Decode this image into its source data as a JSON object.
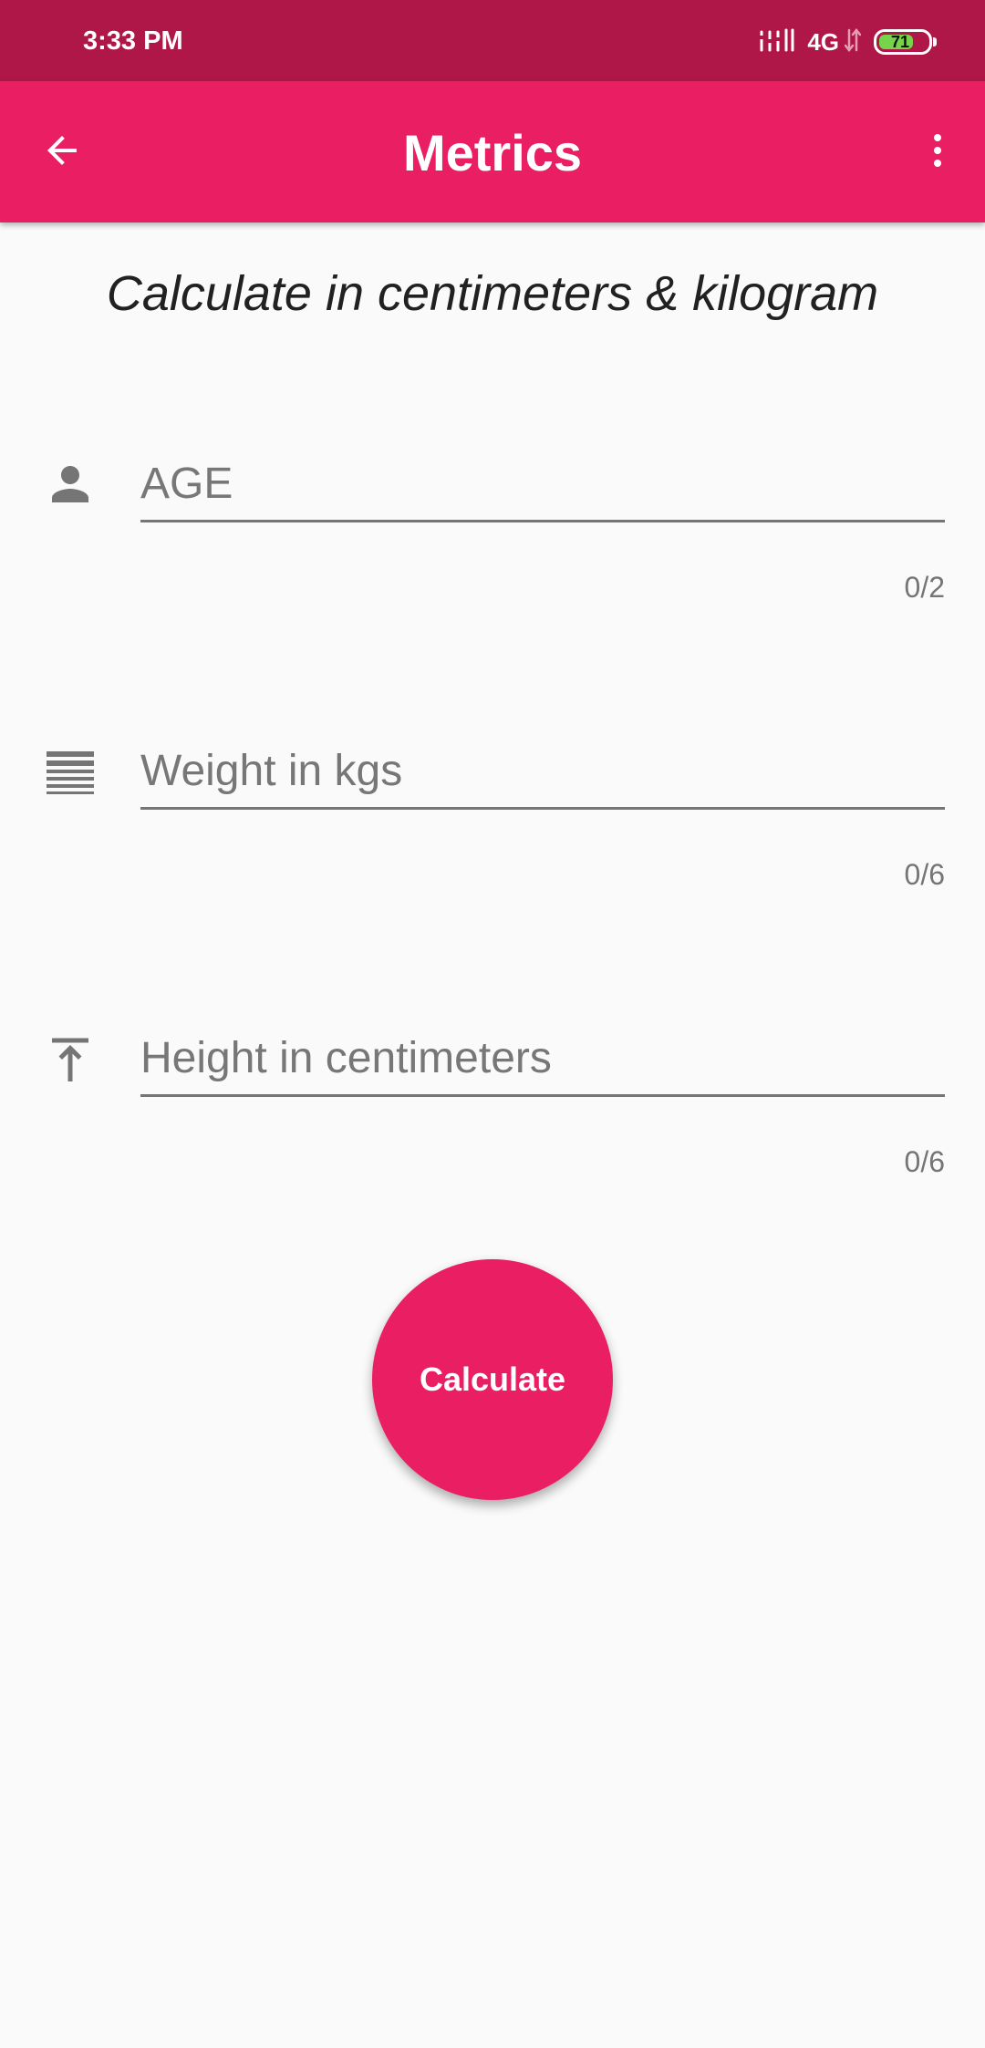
{
  "status_bar": {
    "time": "3:33 PM",
    "network": "4G",
    "battery_level": "71",
    "battery_fraction": 0.71,
    "background": "#b01749"
  },
  "app_bar": {
    "title": "Metrics",
    "back_icon": "arrow-back-icon",
    "menu_icon": "more-vert-icon",
    "background": "#e91e63"
  },
  "subtitle": "Calculate in centimeters & kilogram",
  "fields": [
    {
      "icon": "person-icon",
      "placeholder": "AGE",
      "value": "",
      "counter": "0/2"
    },
    {
      "icon": "weight-lines-icon",
      "placeholder": "Weight in kgs",
      "value": "",
      "counter": "0/6"
    },
    {
      "icon": "height-arrow-icon",
      "placeholder": "Height in centimeters",
      "value": "",
      "counter": "0/6"
    }
  ],
  "calculate_button": {
    "label": "Calculate",
    "color": "#e91e63"
  }
}
